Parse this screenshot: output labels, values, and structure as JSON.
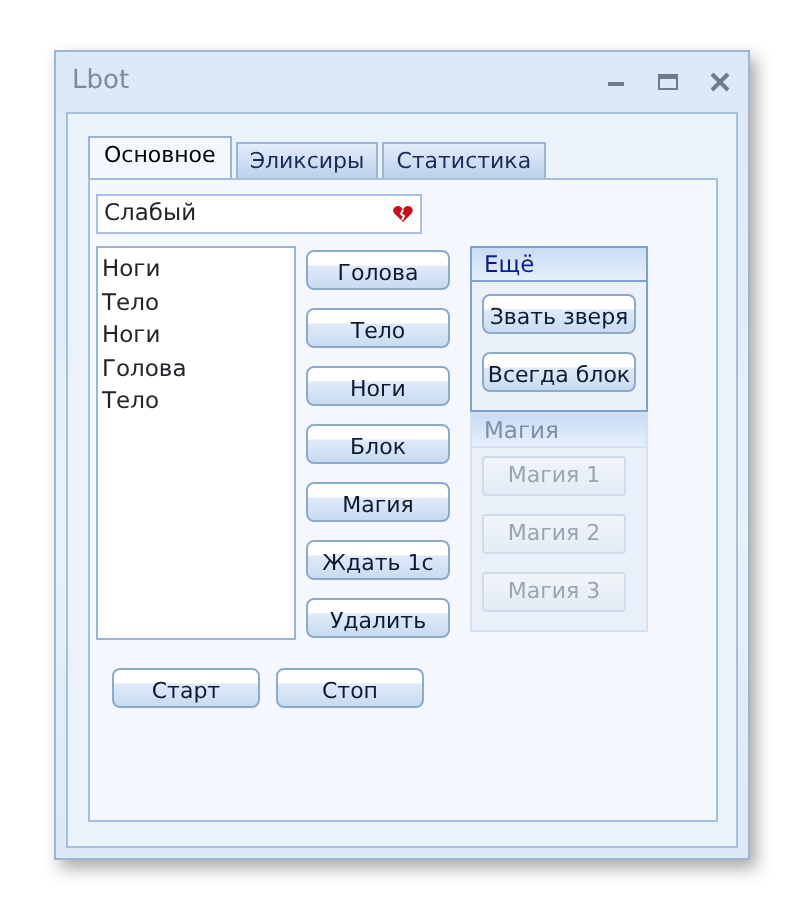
{
  "window": {
    "title": "Lbot"
  },
  "tabs": [
    {
      "label": "Основное",
      "selected": true
    },
    {
      "label": "Эликсиры",
      "selected": false
    },
    {
      "label": "Статистика",
      "selected": false
    }
  ],
  "combo": {
    "value": "Слабый"
  },
  "list": [
    "Ноги",
    "Тело",
    "Ноги",
    "Голова",
    "Тело"
  ],
  "action_buttons": [
    "Голова",
    "Тело",
    "Ноги",
    "Блок",
    "Магия",
    "Ждать 1с",
    "Удалить"
  ],
  "groups": [
    {
      "title": "Ещё",
      "disabled": false,
      "buttons": [
        "Звать зверя",
        "Всегда блок"
      ]
    },
    {
      "title": "Магия",
      "disabled": true,
      "buttons": [
        "Магия 1",
        "Магия 2",
        "Магия 3"
      ]
    }
  ],
  "bottom_buttons": [
    "Старт",
    "Стоп"
  ]
}
